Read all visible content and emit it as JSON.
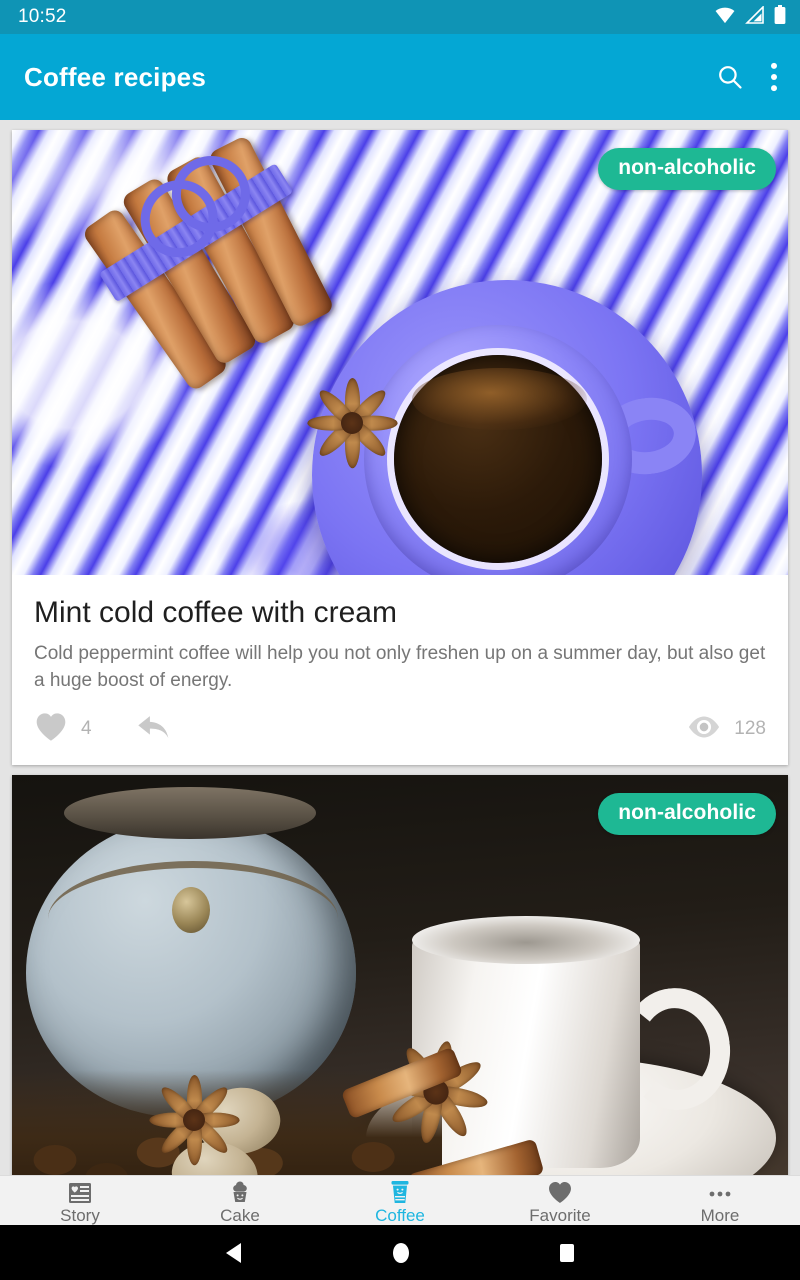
{
  "status_bar": {
    "time": "10:52",
    "icons": [
      "wifi-icon",
      "cellular-signal-icon",
      "battery-icon"
    ]
  },
  "app_bar": {
    "title": "Coffee recipes",
    "search_icon": "search-icon",
    "overflow_icon": "more-vert-icon",
    "background_color": "#04a7d4"
  },
  "theme": {
    "accent": "#04a7d4",
    "badge_color": "#1eb894",
    "active_nav_color": "#1fb6e0",
    "page_background": "#e4e4e4"
  },
  "cards": [
    {
      "badge": "non-alcoholic",
      "title": "Mint cold coffee with cream",
      "description": "Cold peppermint coffee will help you not only freshen up on a summer day, but also get a huge boost of energy.",
      "like_icon": "heart-icon",
      "like_count": "4",
      "share_icon": "reply-arrow-icon",
      "views_icon": "eye-icon",
      "view_count": "128",
      "image_alt": "purple coffee cup with cinnamon sticks and star anise on blue marbled background"
    },
    {
      "badge": "non-alcoholic",
      "title": "",
      "description": "",
      "image_alt": "white coffee cup and saucer with cinnamon sticks, star anise, nutmeg and coffee beans"
    }
  ],
  "bottom_nav": {
    "items": [
      {
        "label": "Story",
        "icon": "article-heart-icon",
        "active": false
      },
      {
        "label": "Cake",
        "icon": "cupcake-icon",
        "active": false
      },
      {
        "label": "Coffee",
        "icon": "coffee-cup-icon",
        "active": true
      },
      {
        "label": "Favorite",
        "icon": "heart-icon",
        "active": false
      },
      {
        "label": "More",
        "icon": "more-horiz-icon",
        "active": false
      }
    ]
  },
  "system_nav": {
    "back": "back-triangle-icon",
    "home": "home-circle-icon",
    "recents": "recents-square-icon"
  }
}
